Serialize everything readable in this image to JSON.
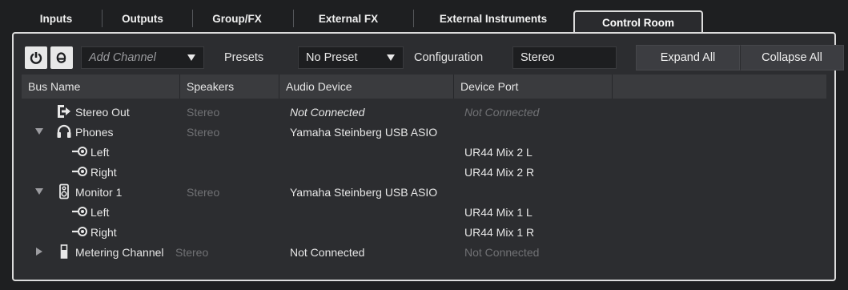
{
  "tabs": [
    "Inputs",
    "Outputs",
    "Group/FX",
    "External FX",
    "External Instruments",
    "Control Room"
  ],
  "active_tab": "Control Room",
  "toolbar": {
    "add_channel_placeholder": "Add Channel",
    "presets_label": "Presets",
    "preset_value": "No Preset",
    "configuration_label": "Configuration",
    "configuration_value": "Stereo",
    "expand_all_label": "Expand All",
    "collapse_all_label": "Collapse All"
  },
  "columns": [
    "Bus Name",
    "Speakers",
    "Audio Device",
    "Device Port"
  ],
  "rows": [
    {
      "name": "Stereo Out",
      "speakers": "Stereo",
      "device": "Not Connected",
      "port": "Not Connected"
    },
    {
      "name": "Phones",
      "speakers": "Stereo",
      "device": "Yamaha Steinberg USB ASIO",
      "port": ""
    },
    {
      "name": "Left",
      "speakers": "",
      "device": "",
      "port": "UR44 Mix 2 L"
    },
    {
      "name": "Right",
      "speakers": "",
      "device": "",
      "port": "UR44 Mix 2 R"
    },
    {
      "name": "Monitor 1",
      "speakers": "Stereo",
      "device": "Yamaha Steinberg USB ASIO",
      "port": ""
    },
    {
      "name": "Left",
      "speakers": "",
      "device": "",
      "port": "UR44 Mix 1 L"
    },
    {
      "name": "Right",
      "speakers": "",
      "device": "",
      "port": "UR44 Mix 1 R"
    },
    {
      "name": "Metering Channel",
      "speakers": "Stereo",
      "device": "Not Connected",
      "port": "Not Connected"
    }
  ],
  "icons": {
    "power": "power-icon",
    "edit": "edit-e-icon",
    "stereo_out": "output-arrow-icon",
    "phones": "headphones-icon",
    "monitor": "speaker-icon",
    "port": "port-connector-icon",
    "metering": "meter-icon"
  },
  "colors": {
    "background": "#1e1f21",
    "panel": "#2c2d30",
    "header": "#3a3b3e",
    "dim_text": "#707174",
    "border": "#dcdcdc"
  }
}
